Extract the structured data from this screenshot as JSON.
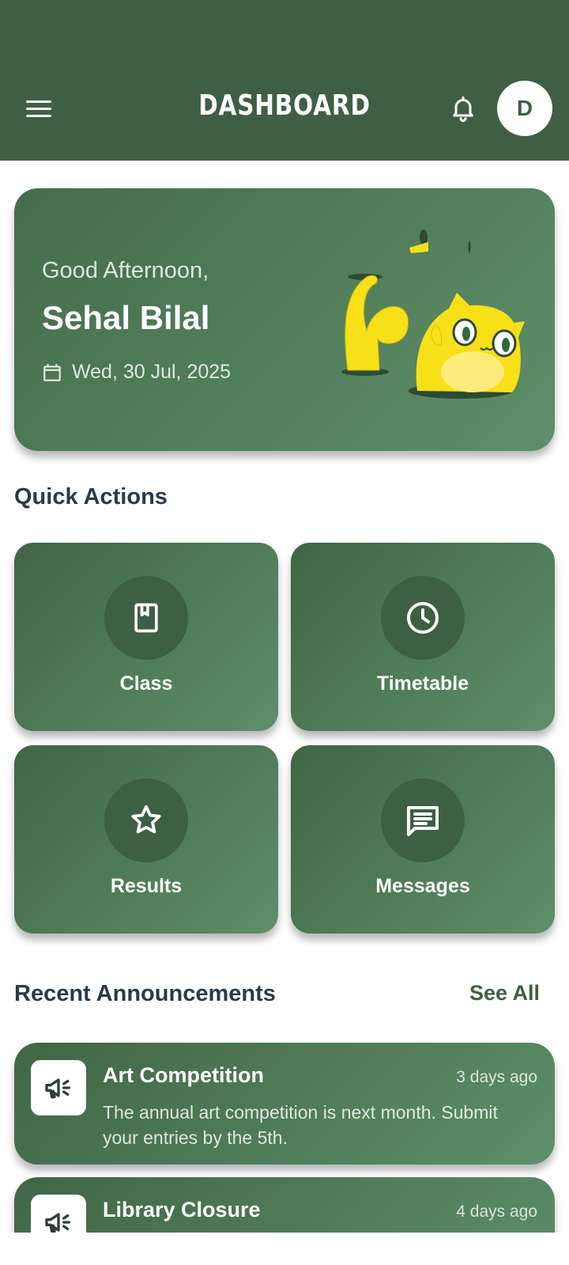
{
  "appbar": {
    "title": "DASHBOARD",
    "avatar_initial": "D",
    "menu_icon": "hamburger-icon",
    "bell_icon": "bell-icon"
  },
  "greeting": {
    "salutation": "Good Afternoon,",
    "name": "Sehal Bilal",
    "date": "Wed, 30 Jul, 2025",
    "date_icon": "calendar-icon"
  },
  "quick_actions": {
    "title": "Quick Actions",
    "items": [
      {
        "label": "Class",
        "icon": "book-icon"
      },
      {
        "label": "Timetable",
        "icon": "clock-icon"
      },
      {
        "label": "Results",
        "icon": "star-icon"
      },
      {
        "label": "Messages",
        "icon": "message-icon"
      }
    ]
  },
  "announcements": {
    "title": "Recent Announcements",
    "see_all": "See All",
    "items": [
      {
        "title": "Art Competition",
        "time": "3 days ago",
        "body": "The annual art competition is next month. Submit your entries by the 5th.",
        "icon": "megaphone-icon"
      },
      {
        "title": "Library Closure",
        "time": "4 days ago",
        "body": "",
        "icon": "megaphone-icon"
      }
    ]
  },
  "colors": {
    "primary": "#3f5f44",
    "card_gradient_start": "#456d4b",
    "card_gradient_end": "#5d8f69",
    "heading_text": "#2a3a4a",
    "mascot_yellow": "#f7e017"
  }
}
